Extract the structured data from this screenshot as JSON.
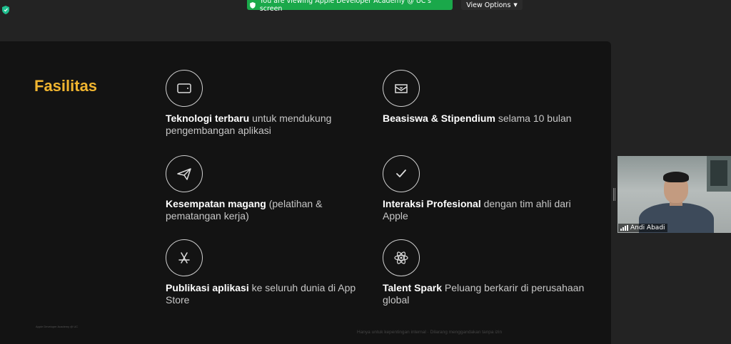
{
  "banner": {
    "text": "You are viewing Apple Developer Academy @ UC's screen"
  },
  "view_options": {
    "label": "View Options"
  },
  "slide": {
    "title": "Fasilitas",
    "items": [
      {
        "icon": "tablet-icon",
        "bold": "Teknologi terbaru",
        "rest": " untuk mendukung pengembangan aplikasi"
      },
      {
        "icon": "envelope-heart-icon",
        "bold": "Beasiswa & Stipendium",
        "rest": " selama 10 bulan"
      },
      {
        "icon": "paper-plane-icon",
        "bold": "Kesempatan magang",
        "rest": " (pelatihan & pematangan kerja)"
      },
      {
        "icon": "checkmark-icon",
        "bold": "Interaksi Profesional",
        "rest": " dengan tim ahli dari Apple"
      },
      {
        "icon": "app-store-icon",
        "bold": "Publikasi aplikasi",
        "rest": " ke seluruh dunia di App Store"
      },
      {
        "icon": "atom-icon",
        "bold": "Talent Spark",
        "rest": " Peluang berkarir di perusahaan global"
      }
    ],
    "footer_left": "Apple Developer Academy @ UC",
    "footer_right": "Hanya untuk kepentingan internal · Dilarang menggandakan tanpa izin"
  },
  "video": {
    "participant_name": "Andi Abadi"
  },
  "colors": {
    "accent": "#f0b530",
    "banner_green": "#1aa84a",
    "slide_bg": "#131313"
  }
}
